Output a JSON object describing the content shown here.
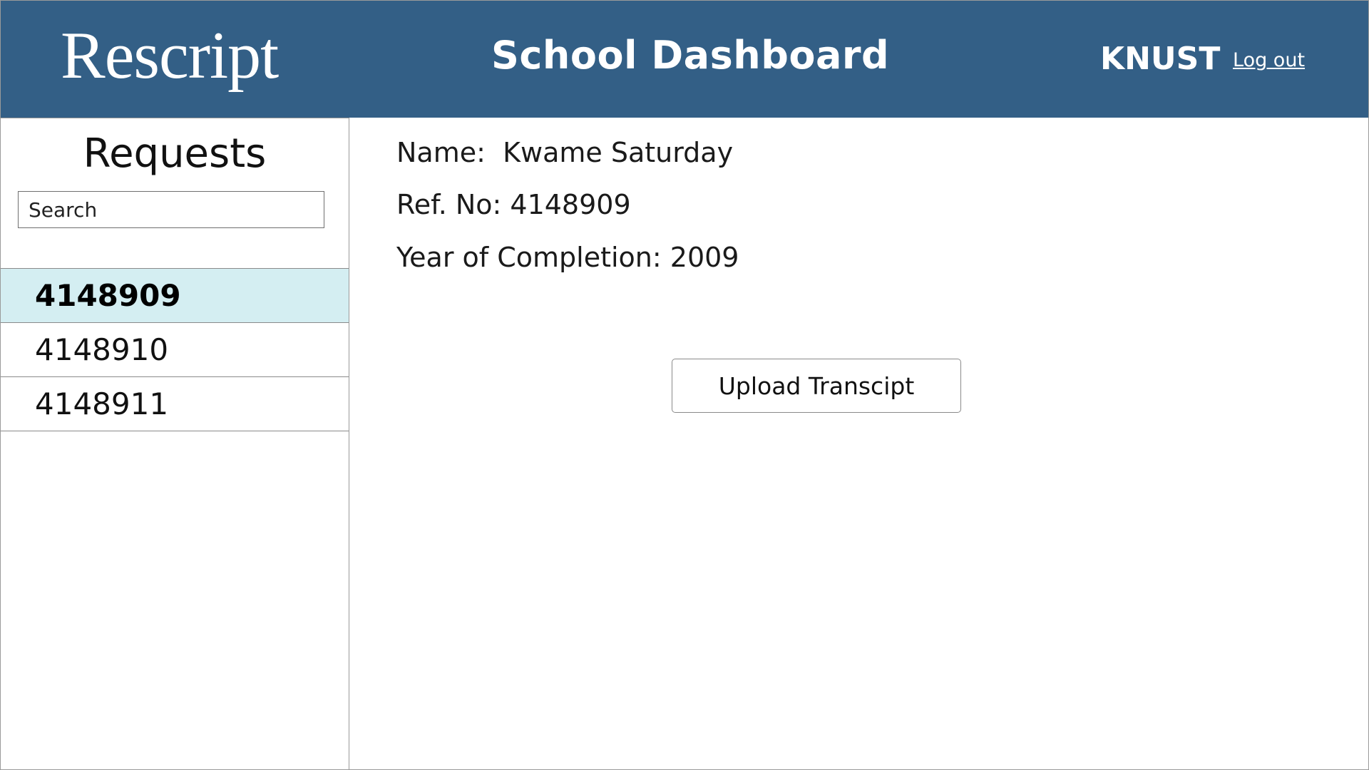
{
  "header": {
    "logo": "Rescript",
    "title": "School Dashboard",
    "school": "KNUST",
    "logout_label": "Log out"
  },
  "sidebar": {
    "title": "Requests",
    "search": {
      "placeholder": "Search",
      "value": ""
    },
    "items": [
      {
        "label": "4148909",
        "selected": true
      },
      {
        "label": "4148910",
        "selected": false
      },
      {
        "label": "4148911",
        "selected": false
      }
    ]
  },
  "detail": {
    "name_line": "Name:  Kwame Saturday",
    "ref_line": "Ref. No: 4148909",
    "year_line": "Year of Completion: 2009"
  },
  "actions": {
    "upload_label": "Upload Transcipt"
  },
  "colors": {
    "header_bg": "#335f86",
    "selected_row_bg": "#d4eef2"
  }
}
